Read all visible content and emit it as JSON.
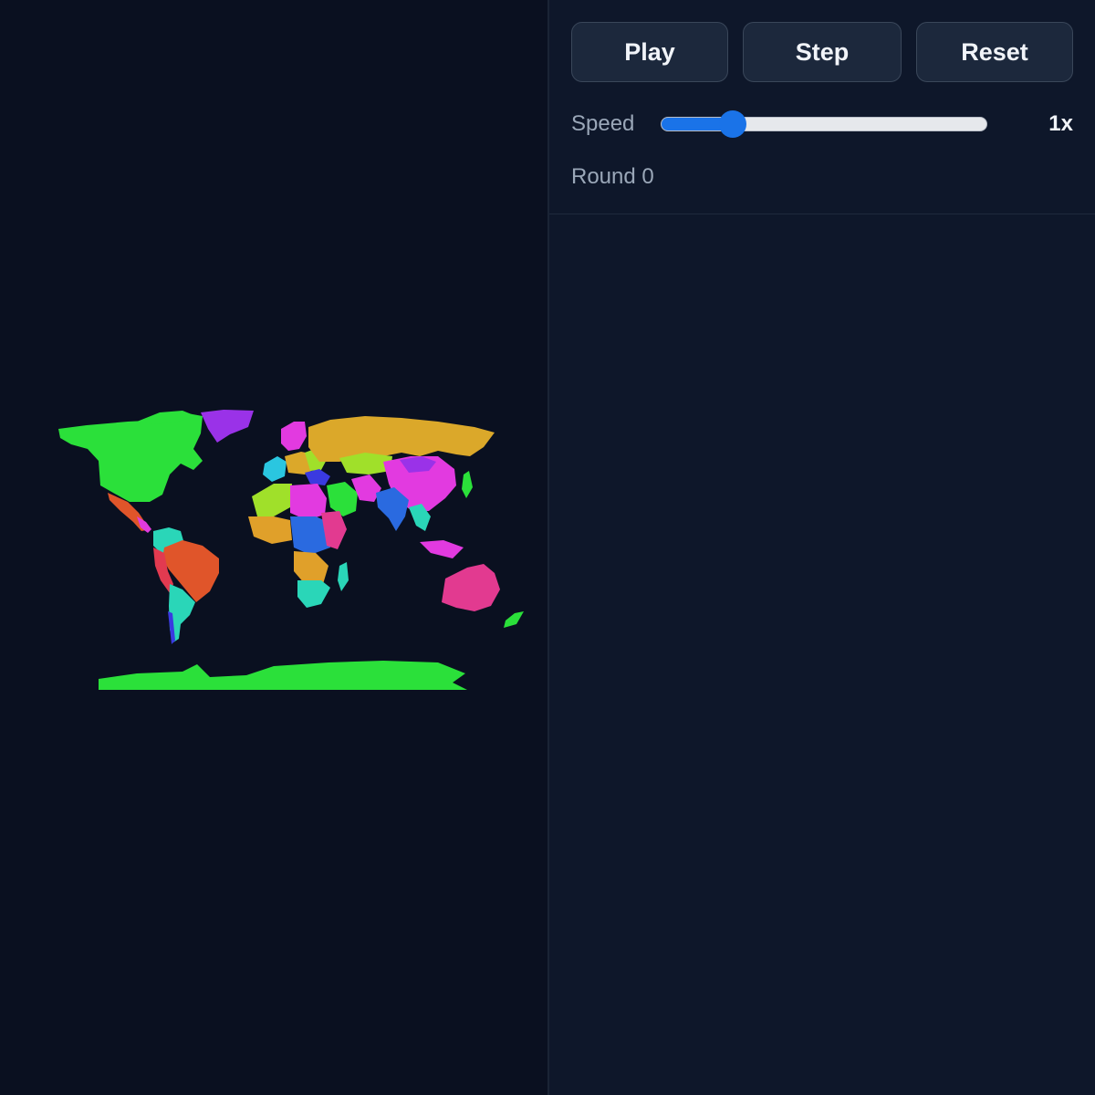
{
  "controls": {
    "play_label": "Play",
    "step_label": "Step",
    "reset_label": "Reset",
    "speed_label": "Speed",
    "speed_value": "1x",
    "speed_fraction": 0.22,
    "round_label": "Round 0"
  },
  "colors": {
    "background": "#0a1020",
    "panel": "#0e172a",
    "accent": "#1a73e8",
    "green": "#2be03a",
    "purple": "#9a32e8",
    "gold": "#dba82a",
    "magenta": "#e23ae0",
    "pink": "#e23a90",
    "orange": "#e0552a",
    "teal": "#2ad6b8",
    "cyan": "#2ac6e0",
    "blue": "#2a6ae0",
    "royal": "#3a3ae0",
    "lime": "#a0e02a"
  }
}
